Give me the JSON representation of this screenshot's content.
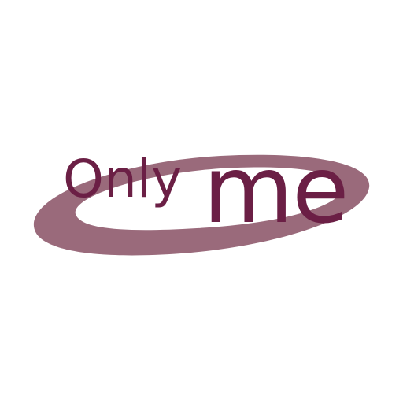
{
  "logo": {
    "word_small": "Only",
    "word_large": "me",
    "colors": {
      "text": "#6b1f45",
      "swoosh": "#9a6a7b",
      "background": "#ffffff"
    }
  }
}
